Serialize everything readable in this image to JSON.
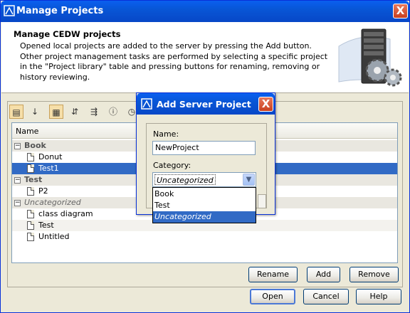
{
  "window": {
    "title": "Manage Projects",
    "close_label": "X"
  },
  "header": {
    "title": "Manage CEDW projects",
    "description": "Opened local projects are added to the server by pressing the Add button. Other project management tasks are performed by selecting a specific project in the \"Project library\" table and pressing buttons for renaming, removing or history reviewing.",
    "image_icon": "server-gears-icon"
  },
  "toolbar": {
    "buttons": [
      {
        "icon": "group-by-category-icon",
        "glyph": "▤"
      },
      {
        "icon": "sort-alphabetical-icon",
        "glyph": "↓"
      },
      {
        "icon": "filter-icon",
        "glyph": "▦"
      },
      {
        "icon": "expand-all-icon",
        "glyph": "⇵"
      },
      {
        "icon": "collapse-all-icon",
        "glyph": "⇶"
      },
      {
        "icon": "info-icon",
        "glyph": "ⓘ"
      },
      {
        "icon": "history-icon",
        "glyph": "◷"
      }
    ]
  },
  "tree": {
    "column_header": "Name",
    "rows": [
      {
        "type": "group",
        "label": "Book",
        "toggle": "−"
      },
      {
        "type": "project",
        "label": "Donut"
      },
      {
        "type": "project",
        "label": "Test1",
        "selected": true
      },
      {
        "type": "group",
        "label": "Test",
        "toggle": "−"
      },
      {
        "type": "project",
        "label": "P2"
      },
      {
        "type": "group",
        "label": "Uncategorized",
        "toggle": "−",
        "italic": true
      },
      {
        "type": "project",
        "label": "class diagram"
      },
      {
        "type": "project",
        "label": "Test"
      },
      {
        "type": "project",
        "label": "Untitled"
      }
    ]
  },
  "panel_buttons": {
    "rename": "Rename",
    "add": "Add",
    "remove": "Remove"
  },
  "footer_buttons": {
    "open": "Open",
    "cancel": "Cancel",
    "help": "Help"
  },
  "dialog": {
    "title": "Add Server Project",
    "close_label": "X",
    "name_label": "Name:",
    "name_value": "NewProject",
    "category_label": "Category:",
    "category_value": "Uncategorized",
    "category_options": [
      "Book",
      "Test",
      "Uncategorized"
    ],
    "selected_option_index": 2
  },
  "colors": {
    "titlebar": "#0856d6",
    "selection": "#316ac5",
    "window_bg": "#ece9d8"
  }
}
